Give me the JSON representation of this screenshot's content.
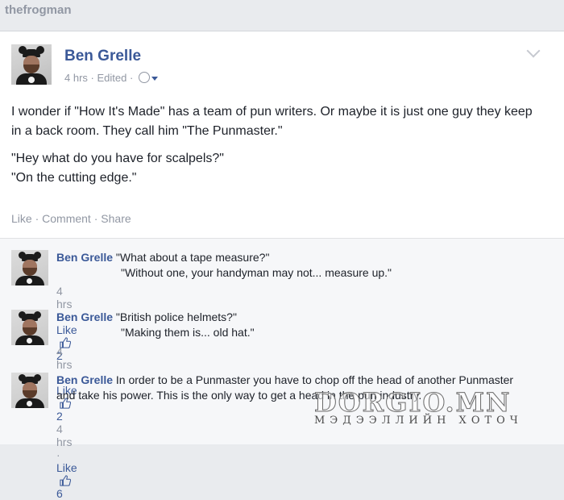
{
  "page_label": "thefrogman",
  "post": {
    "author": "Ben Grelle",
    "time": "4 hrs",
    "edited": "Edited",
    "separator": "·",
    "paragraph1": "I wonder if \"How It's Made\" has a team of pun writers. Or maybe it is just one guy they keep in a back room. They call him \"The Punmaster.\"",
    "line2": "\"Hey what do you have for scalpels?\"",
    "line3": "\"On the cutting edge.\"",
    "actions": {
      "like": "Like",
      "comment": "Comment",
      "share": "Share"
    }
  },
  "comments": [
    {
      "author": "Ben Grelle",
      "line1": "\"What about a tape measure?\"",
      "line2": "\"Without one, your handyman may not... measure up.\"",
      "time": "4 hrs",
      "like": "Like",
      "likes": "2"
    },
    {
      "author": "Ben Grelle",
      "line1": "\"British police helmets?\"",
      "line2": "\"Making them is... old hat.\"",
      "time": "4 hrs",
      "like": "Like",
      "likes": "2"
    },
    {
      "author": "Ben Grelle",
      "text": "In order to be a Punmaster you have to chop off the head of another Punmaster and take his power. This is the only way to get a head in the pun industry.",
      "time": "4 hrs",
      "like": "Like",
      "likes": "6"
    }
  ],
  "watermark": {
    "brand": "DORGIO.MN",
    "tagline": "МЭДЭЭЛЛИЙН ХОТОЧ"
  },
  "colors": {
    "link": "#3b5998",
    "meta": "#9197a3",
    "text": "#1d2129",
    "comment_bg": "#f6f7f9"
  }
}
